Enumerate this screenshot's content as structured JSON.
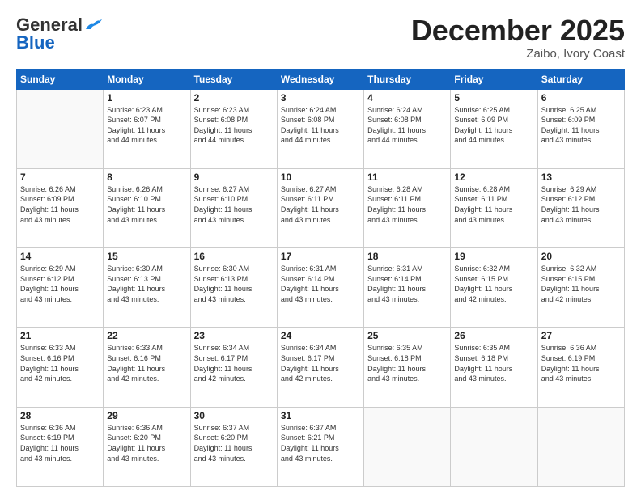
{
  "header": {
    "logo_line1": "General",
    "logo_line2": "Blue",
    "month": "December 2025",
    "location": "Zaibo, Ivory Coast"
  },
  "weekdays": [
    "Sunday",
    "Monday",
    "Tuesday",
    "Wednesday",
    "Thursday",
    "Friday",
    "Saturday"
  ],
  "weeks": [
    [
      {
        "day": "",
        "info": ""
      },
      {
        "day": "1",
        "info": "Sunrise: 6:23 AM\nSunset: 6:07 PM\nDaylight: 11 hours\nand 44 minutes."
      },
      {
        "day": "2",
        "info": "Sunrise: 6:23 AM\nSunset: 6:08 PM\nDaylight: 11 hours\nand 44 minutes."
      },
      {
        "day": "3",
        "info": "Sunrise: 6:24 AM\nSunset: 6:08 PM\nDaylight: 11 hours\nand 44 minutes."
      },
      {
        "day": "4",
        "info": "Sunrise: 6:24 AM\nSunset: 6:08 PM\nDaylight: 11 hours\nand 44 minutes."
      },
      {
        "day": "5",
        "info": "Sunrise: 6:25 AM\nSunset: 6:09 PM\nDaylight: 11 hours\nand 44 minutes."
      },
      {
        "day": "6",
        "info": "Sunrise: 6:25 AM\nSunset: 6:09 PM\nDaylight: 11 hours\nand 43 minutes."
      }
    ],
    [
      {
        "day": "7",
        "info": "Sunrise: 6:26 AM\nSunset: 6:09 PM\nDaylight: 11 hours\nand 43 minutes."
      },
      {
        "day": "8",
        "info": "Sunrise: 6:26 AM\nSunset: 6:10 PM\nDaylight: 11 hours\nand 43 minutes."
      },
      {
        "day": "9",
        "info": "Sunrise: 6:27 AM\nSunset: 6:10 PM\nDaylight: 11 hours\nand 43 minutes."
      },
      {
        "day": "10",
        "info": "Sunrise: 6:27 AM\nSunset: 6:11 PM\nDaylight: 11 hours\nand 43 minutes."
      },
      {
        "day": "11",
        "info": "Sunrise: 6:28 AM\nSunset: 6:11 PM\nDaylight: 11 hours\nand 43 minutes."
      },
      {
        "day": "12",
        "info": "Sunrise: 6:28 AM\nSunset: 6:11 PM\nDaylight: 11 hours\nand 43 minutes."
      },
      {
        "day": "13",
        "info": "Sunrise: 6:29 AM\nSunset: 6:12 PM\nDaylight: 11 hours\nand 43 minutes."
      }
    ],
    [
      {
        "day": "14",
        "info": "Sunrise: 6:29 AM\nSunset: 6:12 PM\nDaylight: 11 hours\nand 43 minutes."
      },
      {
        "day": "15",
        "info": "Sunrise: 6:30 AM\nSunset: 6:13 PM\nDaylight: 11 hours\nand 43 minutes."
      },
      {
        "day": "16",
        "info": "Sunrise: 6:30 AM\nSunset: 6:13 PM\nDaylight: 11 hours\nand 43 minutes."
      },
      {
        "day": "17",
        "info": "Sunrise: 6:31 AM\nSunset: 6:14 PM\nDaylight: 11 hours\nand 43 minutes."
      },
      {
        "day": "18",
        "info": "Sunrise: 6:31 AM\nSunset: 6:14 PM\nDaylight: 11 hours\nand 43 minutes."
      },
      {
        "day": "19",
        "info": "Sunrise: 6:32 AM\nSunset: 6:15 PM\nDaylight: 11 hours\nand 42 minutes."
      },
      {
        "day": "20",
        "info": "Sunrise: 6:32 AM\nSunset: 6:15 PM\nDaylight: 11 hours\nand 42 minutes."
      }
    ],
    [
      {
        "day": "21",
        "info": "Sunrise: 6:33 AM\nSunset: 6:16 PM\nDaylight: 11 hours\nand 42 minutes."
      },
      {
        "day": "22",
        "info": "Sunrise: 6:33 AM\nSunset: 6:16 PM\nDaylight: 11 hours\nand 42 minutes."
      },
      {
        "day": "23",
        "info": "Sunrise: 6:34 AM\nSunset: 6:17 PM\nDaylight: 11 hours\nand 42 minutes."
      },
      {
        "day": "24",
        "info": "Sunrise: 6:34 AM\nSunset: 6:17 PM\nDaylight: 11 hours\nand 42 minutes."
      },
      {
        "day": "25",
        "info": "Sunrise: 6:35 AM\nSunset: 6:18 PM\nDaylight: 11 hours\nand 43 minutes."
      },
      {
        "day": "26",
        "info": "Sunrise: 6:35 AM\nSunset: 6:18 PM\nDaylight: 11 hours\nand 43 minutes."
      },
      {
        "day": "27",
        "info": "Sunrise: 6:36 AM\nSunset: 6:19 PM\nDaylight: 11 hours\nand 43 minutes."
      }
    ],
    [
      {
        "day": "28",
        "info": "Sunrise: 6:36 AM\nSunset: 6:19 PM\nDaylight: 11 hours\nand 43 minutes."
      },
      {
        "day": "29",
        "info": "Sunrise: 6:36 AM\nSunset: 6:20 PM\nDaylight: 11 hours\nand 43 minutes."
      },
      {
        "day": "30",
        "info": "Sunrise: 6:37 AM\nSunset: 6:20 PM\nDaylight: 11 hours\nand 43 minutes."
      },
      {
        "day": "31",
        "info": "Sunrise: 6:37 AM\nSunset: 6:21 PM\nDaylight: 11 hours\nand 43 minutes."
      },
      {
        "day": "",
        "info": ""
      },
      {
        "day": "",
        "info": ""
      },
      {
        "day": "",
        "info": ""
      }
    ]
  ]
}
